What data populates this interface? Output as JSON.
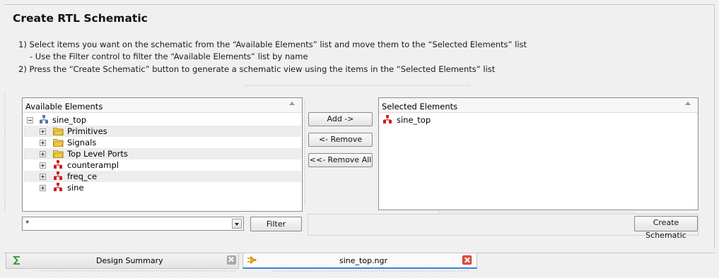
{
  "header": {
    "title": "Create RTL Schematic"
  },
  "instructions": {
    "line1": "1) Select items you want on the schematic from the “Available Elements” list and move them to the “Selected Elements” list",
    "line2": "- Use the Filter control to filter the “Available Elements” list by name",
    "line3": "2) Press the “Create Schematic” button to generate a schematic view using the items in the “Selected Elements” list"
  },
  "available": {
    "header": "Available Elements",
    "root": {
      "label": "sine_top",
      "icon": "hierarchy-icon",
      "expanded": true
    },
    "items": [
      {
        "label": "Primitives",
        "icon": "folder-icon"
      },
      {
        "label": "Signals",
        "icon": "folder-icon"
      },
      {
        "label": "Top Level Ports",
        "icon": "folder-icon"
      },
      {
        "label": "counterampl",
        "icon": "module-icon"
      },
      {
        "label": "freq_ce",
        "icon": "module-icon"
      },
      {
        "label": "sine",
        "icon": "module-icon"
      }
    ]
  },
  "buttons": {
    "add": "Add ->",
    "remove": "<- Remove",
    "remove_all": "<<- Remove All"
  },
  "selected": {
    "header": "Selected Elements",
    "items": [
      {
        "label": "sine_top",
        "icon": "module-icon"
      }
    ]
  },
  "filter": {
    "value": "*",
    "button": "Filter"
  },
  "create_button": "Create Schematic",
  "tabs": [
    {
      "label": "Design Summary",
      "icon": "sigma-icon",
      "active": false
    },
    {
      "label": "sine_top.ngr",
      "icon": "schematic-icon",
      "active": true
    }
  ],
  "colors": {
    "module_icon": "#cc1f1f",
    "hier_icon": "#5a74a8",
    "folder_icon": "#f2c93c",
    "close_active": "#e0543c",
    "close_inactive": "#a8a8a8",
    "active_tab_underline": "#3d7fd9"
  }
}
